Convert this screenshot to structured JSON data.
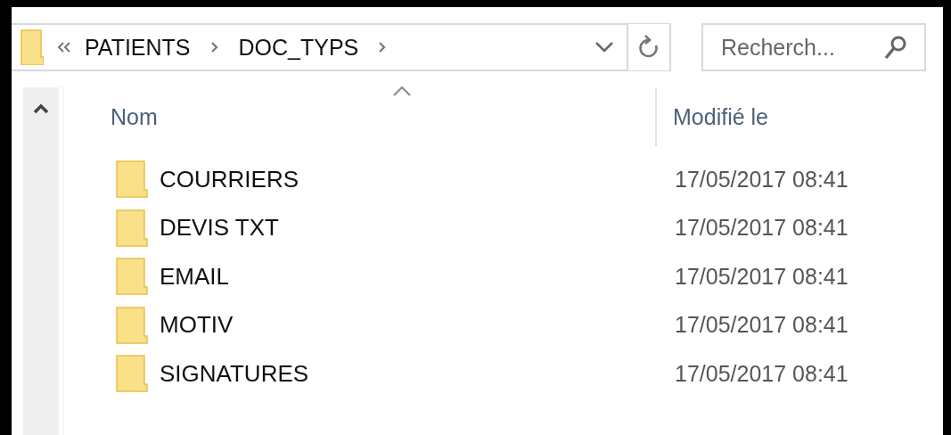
{
  "address_bar": {
    "path": [
      "PATIENTS",
      "DOC_TYPS"
    ]
  },
  "search": {
    "placeholder": "Recherch..."
  },
  "columns": [
    {
      "label": "Nom",
      "sorted": true
    },
    {
      "label": "Modifié le",
      "sorted": false
    }
  ],
  "rows": [
    {
      "name": "COURRIERS",
      "modified": "17/05/2017 08:41"
    },
    {
      "name": "DEVIS TXT",
      "modified": "17/05/2017 08:41"
    },
    {
      "name": "EMAIL",
      "modified": "17/05/2017 08:41"
    },
    {
      "name": "MOTIV",
      "modified": "17/05/2017 08:41"
    },
    {
      "name": "SIGNATURES",
      "modified": "17/05/2017 08:41"
    }
  ]
}
